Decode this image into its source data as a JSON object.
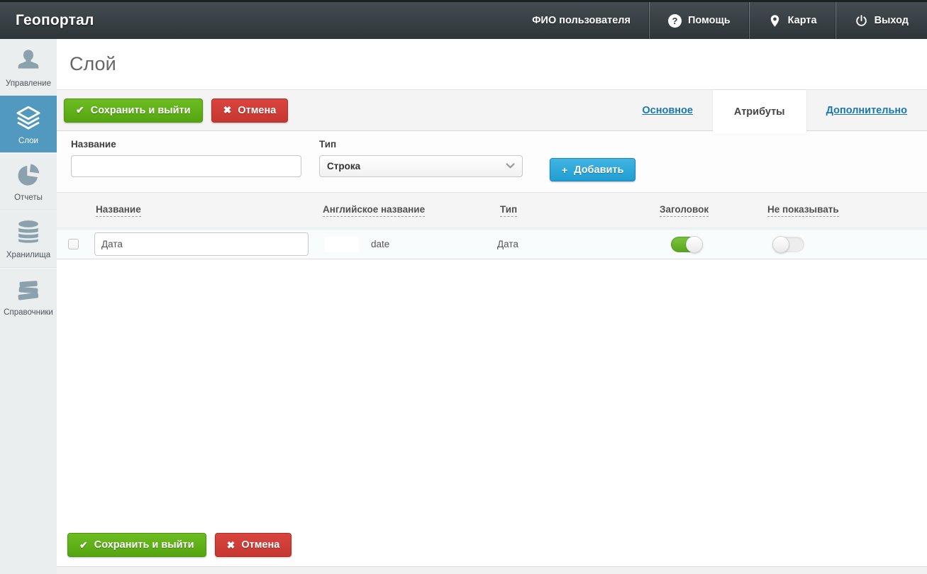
{
  "header": {
    "brand": "Геопортал",
    "user_name": "ФИО пользователя",
    "help_label": "Помощь",
    "map_label": "Карта",
    "logout_label": "Выход",
    "help_glyph": "?"
  },
  "sidebar": {
    "items": [
      {
        "label": "Управление",
        "icon": "user-icon",
        "active": false
      },
      {
        "label": "Слои",
        "icon": "layers-icon",
        "active": true
      },
      {
        "label": "Отчеты",
        "icon": "pie-chart-icon",
        "active": false
      },
      {
        "label": "Хранилища",
        "icon": "database-icon",
        "active": false
      },
      {
        "label": "Справочники",
        "icon": "books-icon",
        "active": false
      }
    ]
  },
  "page": {
    "title": "Слой"
  },
  "actions": {
    "save_label": "Сохранить и выйти",
    "cancel_label": "Отмена",
    "save_glyph": "✔",
    "cancel_glyph": "✖",
    "add_label": "Добавить",
    "add_glyph": "+"
  },
  "tabs": [
    {
      "label": "Основное",
      "active": false
    },
    {
      "label": "Атрибуты",
      "active": true
    },
    {
      "label": "Дополнительно",
      "active": false
    }
  ],
  "form": {
    "name_label": "Название",
    "name_value": "",
    "type_label": "Тип",
    "type_value": "Строка"
  },
  "table": {
    "headers": {
      "name": "Название",
      "english_name": "Английское название",
      "type": "Тип",
      "header": "Заголовок",
      "hide": "Не показывать"
    },
    "rows": [
      {
        "name": "Дата",
        "english_name": "date",
        "type": "Дата",
        "header_toggle": true,
        "hide_toggle": false,
        "checked": false
      }
    ]
  },
  "colors": {
    "topbar_dark": "#353c40",
    "sidebar_active_blue": "#5299c0",
    "button_green": "#5ead18",
    "button_red": "#ce3b34",
    "button_blue": "#2ba6d8",
    "tab_link_blue": "#1b77ae",
    "toggle_on_green": "#6ab52e"
  }
}
